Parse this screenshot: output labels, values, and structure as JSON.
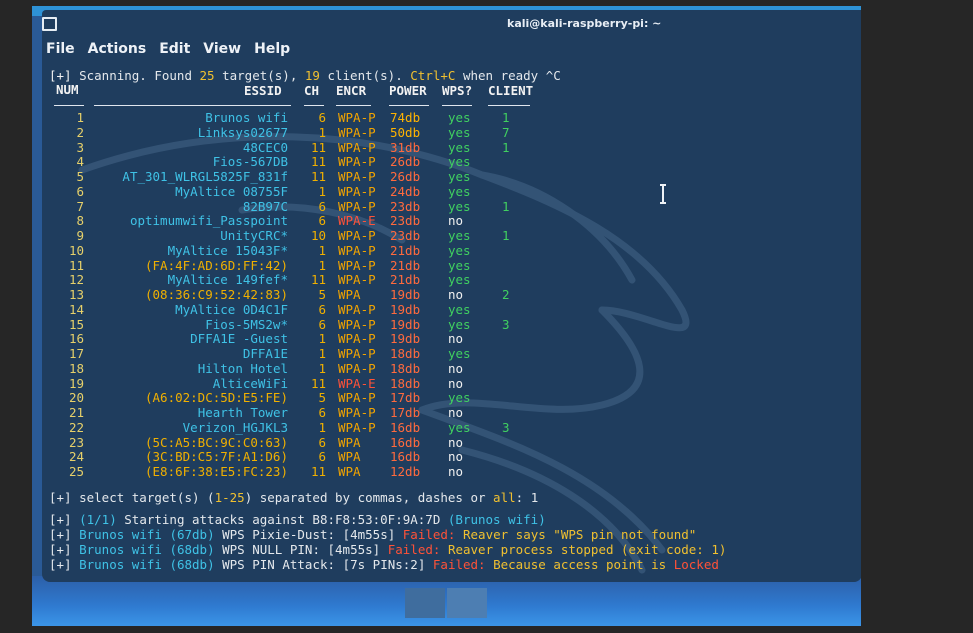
{
  "window": {
    "title": "kali@kali-raspberry-pi: ~"
  },
  "menu": [
    "File",
    "Actions",
    "Edit",
    "View",
    "Help"
  ],
  "scan_line": {
    "prefix": "[+]",
    "text1": " Scanning. Found ",
    "targets": "25",
    "text2": " target(s), ",
    "clients": "19",
    "text3": " client(s). ",
    "ctrl": "Ctrl+C",
    "text4": " when ready ",
    "caret": "^C"
  },
  "table": {
    "headers": {
      "num": "NUM",
      "essid": "ESSID",
      "ch": "CH",
      "encr": "ENCR",
      "power": "POWER",
      "wps": "WPS?",
      "client": "CLIENT"
    },
    "rows": [
      {
        "num": "1",
        "essid": "Brunos wifi",
        "ch": "6",
        "encr": "WPA-P",
        "power": "74db",
        "wps": "yes",
        "client": "1"
      },
      {
        "num": "2",
        "essid": "Linksys02677",
        "ch": "1",
        "encr": "WPA-P",
        "power": "50db",
        "wps": "yes",
        "client": "7"
      },
      {
        "num": "3",
        "essid": "48CEC0",
        "ch": "11",
        "encr": "WPA-P",
        "power": "31db",
        "wps": "yes",
        "client": "1"
      },
      {
        "num": "4",
        "essid": "Fios-567DB",
        "ch": "11",
        "encr": "WPA-P",
        "power": "26db",
        "wps": "yes",
        "client": ""
      },
      {
        "num": "5",
        "essid": "AT_301_WLRGL5825F_831f",
        "ch": "11",
        "encr": "WPA-P",
        "power": "26db",
        "wps": "yes",
        "client": ""
      },
      {
        "num": "6",
        "essid": "MyAltice 08755F",
        "ch": "1",
        "encr": "WPA-P",
        "power": "24db",
        "wps": "yes",
        "client": ""
      },
      {
        "num": "7",
        "essid": "82B97C",
        "ch": "6",
        "encr": "WPA-P",
        "power": "23db",
        "wps": "yes",
        "client": "1"
      },
      {
        "num": "8",
        "essid": "optimumwifi_Passpoint",
        "ch": "6",
        "encr": "WPA-E",
        "power": "23db",
        "wps": "no",
        "client": ""
      },
      {
        "num": "9",
        "essid": "UnityCRC*",
        "ch": "10",
        "encr": "WPA-P",
        "power": "23db",
        "wps": "yes",
        "client": "1"
      },
      {
        "num": "10",
        "essid": "MyAltice 15043F*",
        "ch": "1",
        "encr": "WPA-P",
        "power": "21db",
        "wps": "yes",
        "client": ""
      },
      {
        "num": "11",
        "essid": "(FA:4F:AD:6D:FF:42)",
        "ch": "1",
        "encr": "WPA-P",
        "power": "21db",
        "wps": "yes",
        "client": ""
      },
      {
        "num": "12",
        "essid": "MyAltice 149fef*",
        "ch": "11",
        "encr": "WPA-P",
        "power": "21db",
        "wps": "yes",
        "client": ""
      },
      {
        "num": "13",
        "essid": "(08:36:C9:52:42:83)",
        "ch": "5",
        "encr": "WPA",
        "power": "19db",
        "wps": "no",
        "client": "2"
      },
      {
        "num": "14",
        "essid": "MyAltice 0D4C1F",
        "ch": "6",
        "encr": "WPA-P",
        "power": "19db",
        "wps": "yes",
        "client": ""
      },
      {
        "num": "15",
        "essid": "Fios-5MS2w*",
        "ch": "6",
        "encr": "WPA-P",
        "power": "19db",
        "wps": "yes",
        "client": "3"
      },
      {
        "num": "16",
        "essid": "DFFA1E -Guest",
        "ch": "1",
        "encr": "WPA-P",
        "power": "19db",
        "wps": "no",
        "client": ""
      },
      {
        "num": "17",
        "essid": "DFFA1E",
        "ch": "1",
        "encr": "WPA-P",
        "power": "18db",
        "wps": "yes",
        "client": ""
      },
      {
        "num": "18",
        "essid": "Hilton Hotel",
        "ch": "1",
        "encr": "WPA-P",
        "power": "18db",
        "wps": "no",
        "client": ""
      },
      {
        "num": "19",
        "essid": "AlticeWiFi",
        "ch": "11",
        "encr": "WPA-E",
        "power": "18db",
        "wps": "no",
        "client": ""
      },
      {
        "num": "20",
        "essid": "(A6:02:DC:5D:E5:FE)",
        "ch": "5",
        "encr": "WPA-P",
        "power": "17db",
        "wps": "yes",
        "client": ""
      },
      {
        "num": "21",
        "essid": "Hearth Tower",
        "ch": "6",
        "encr": "WPA-P",
        "power": "17db",
        "wps": "no",
        "client": ""
      },
      {
        "num": "22",
        "essid": "Verizon_HGJKL3",
        "ch": "1",
        "encr": "WPA-P",
        "power": "16db",
        "wps": "yes",
        "client": "3"
      },
      {
        "num": "23",
        "essid": "(5C:A5:BC:9C:C0:63)",
        "ch": "6",
        "encr": "WPA",
        "power": "16db",
        "wps": "no",
        "client": ""
      },
      {
        "num": "24",
        "essid": "(3C:BD:C5:7F:A1:D6)",
        "ch": "6",
        "encr": "WPA",
        "power": "16db",
        "wps": "no",
        "client": ""
      },
      {
        "num": "25",
        "essid": "(E8:6F:38:E5:FC:23)",
        "ch": "11",
        "encr": "WPA",
        "power": "12db",
        "wps": "no",
        "client": ""
      }
    ]
  },
  "select_line": {
    "prefix": "[+]",
    "text1": " select target(s) (",
    "range": "1-25",
    "text2": ") separated by commas, dashes or ",
    "all": "all",
    "text3": ": ",
    "input": "1"
  },
  "attack_lines": {
    "start": {
      "prefix": "[+]",
      "count": "(1/1)",
      "text1": " Starting attacks against ",
      "bssid": "B8:F8:53:0F:9A:7D",
      "essid": "(Brunos wifi)"
    },
    "pixie": {
      "prefix": "[+]",
      "essid": "Brunos wifi",
      "power": "(67db)",
      "wps": "WPS",
      "attack": "Pixie-Dust:",
      "time": "[4m55s]",
      "failed": "Failed:",
      "msg": "Reaver says \"WPS pin not found\""
    },
    "null": {
      "prefix": "[+]",
      "essid": "Brunos wifi",
      "power": "(68db)",
      "wps": "WPS",
      "attack": "NULL PIN:",
      "time": "[4m55s]",
      "failed": "Failed:",
      "msg": "Reaver process stopped (exit code: 1)"
    },
    "pin": {
      "prefix": "[+]",
      "essid": "Brunos wifi",
      "power": "(68db)",
      "wps": "WPS",
      "attack": "PIN Attack:",
      "time": "[7s PINs:2]",
      "failed": "Failed:",
      "msg": "Because access point is",
      "locked": "Locked"
    }
  },
  "icons": [
    "terminal-icon",
    "ibeam-cursor-icon",
    "kali-dragon-icon"
  ],
  "colors": {
    "cyan": "#3fc2e6",
    "yellow": "#f0b000",
    "green": "#40d060",
    "red": "#ff5238",
    "terminal_bg": "#1f3d5e",
    "desktop_bg": "#2a5a96"
  }
}
